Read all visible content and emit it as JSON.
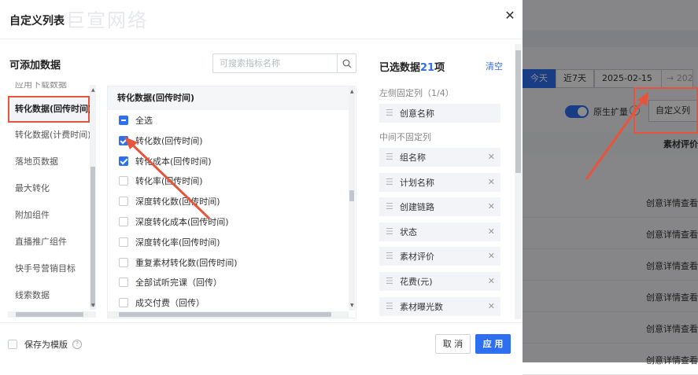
{
  "dialog": {
    "title": "自定义列表",
    "watermark": "巨宣网络",
    "close_icon": "close-icon"
  },
  "available": {
    "title": "可添加数据",
    "search_placeholder": "可搜索指标名称",
    "categories": [
      "应用下载数据",
      "转化数据(回传时间)",
      "转化数据(计费时间)",
      "落地页数据",
      "最大转化",
      "附加组件",
      "直播推广组件",
      "快手号营销目标",
      "线索数据"
    ],
    "active_category": "转化数据(回传时间)"
  },
  "metrics": {
    "header": "转化数据(回传时间)",
    "items": [
      {
        "label": "全选",
        "state": "indeterminate"
      },
      {
        "label": "转化数(回传时间)",
        "state": "checked"
      },
      {
        "label": "转化成本(回传时间)",
        "state": "checked"
      },
      {
        "label": "转化率(回传时间)",
        "state": "unchecked"
      },
      {
        "label": "深度转化数(回传时间)",
        "state": "unchecked"
      },
      {
        "label": "深度转化成本(回传时间)",
        "state": "unchecked"
      },
      {
        "label": "深度转化率(回传时间)",
        "state": "unchecked"
      },
      {
        "label": "重复素材转化数(回传时间)",
        "state": "unchecked"
      },
      {
        "label": "全部试听完课（回传）",
        "state": "unchecked"
      },
      {
        "label": "成交付费（回传）",
        "state": "unchecked"
      }
    ]
  },
  "selected": {
    "title_prefix": "已选数据",
    "count": "21",
    "title_suffix": "项",
    "clear_label": "清空",
    "fixed_label": "左侧固定列（1/4）",
    "fixed_items": [
      "创意名称"
    ],
    "free_label": "中间不固定列",
    "free_items": [
      "组名称",
      "计划名称",
      "创建链路",
      "状态",
      "素材评价",
      "花费(元)",
      "素材曝光数"
    ]
  },
  "footer": {
    "save_template_label": "保存为模版",
    "cancel_label": "取 消",
    "apply_label": "应 用"
  },
  "background": {
    "date_tabs": [
      "今天",
      "近7天"
    ],
    "active_tab": "今天",
    "date_start": "2025-02-15",
    "date_arrow": "→",
    "date_end": "202",
    "toggle_label": "原生扩量",
    "custom_column_button": "自定义列",
    "table_header": "素材评价",
    "row_link": "创意详情查看",
    "row_count": 6
  },
  "colors": {
    "accent": "#2d6ff0",
    "annotation": "#e8533c"
  }
}
